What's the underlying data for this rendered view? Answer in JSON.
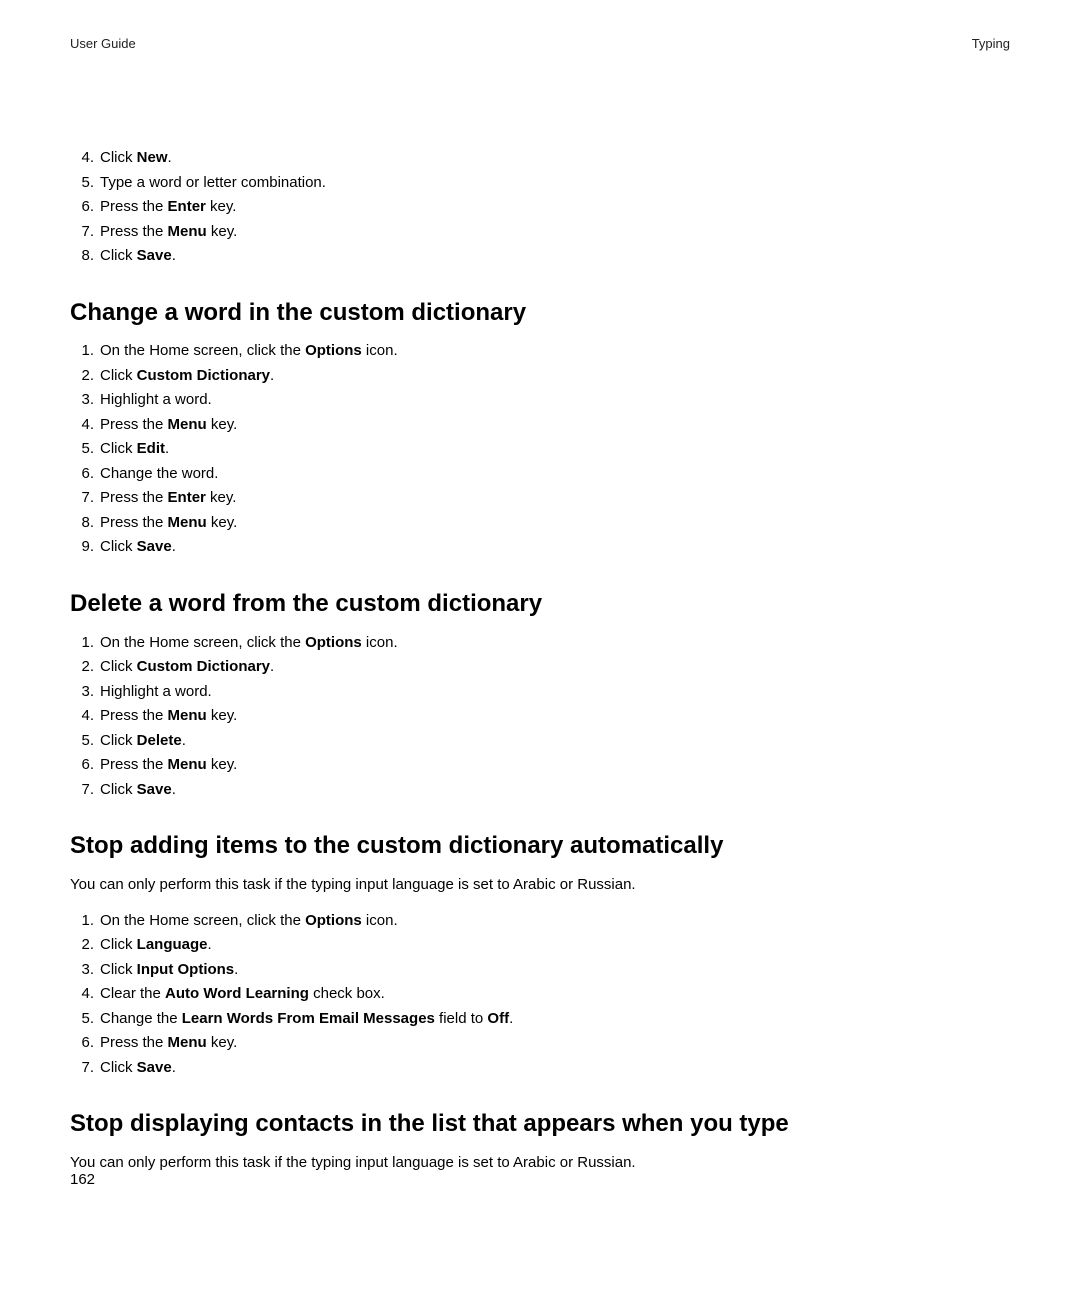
{
  "header": {
    "left": "User Guide",
    "right": "Typing"
  },
  "page_number": "162",
  "intro_steps": {
    "s4_pre": "Click ",
    "s4_b": "New",
    "s4_post": ".",
    "s5": "Type a word or letter combination.",
    "s6_pre": "Press the ",
    "s6_b": "Enter",
    "s6_post": " key.",
    "s7_pre": "Press the ",
    "s7_b": "Menu",
    "s7_post": " key.",
    "s8_pre": "Click ",
    "s8_b": "Save",
    "s8_post": "."
  },
  "section_change": {
    "heading": "Change a word in the custom dictionary",
    "s1_pre": "On the Home screen, click the ",
    "s1_b": "Options",
    "s1_post": " icon.",
    "s2_pre": "Click ",
    "s2_b": "Custom Dictionary",
    "s2_post": ".",
    "s3": "Highlight a word.",
    "s4_pre": "Press the ",
    "s4_b": "Menu",
    "s4_post": " key.",
    "s5_pre": "Click ",
    "s5_b": "Edit",
    "s5_post": ".",
    "s6": "Change the word.",
    "s7_pre": "Press the ",
    "s7_b": "Enter",
    "s7_post": " key.",
    "s8_pre": "Press the ",
    "s8_b": "Menu",
    "s8_post": " key.",
    "s9_pre": "Click ",
    "s9_b": "Save",
    "s9_post": "."
  },
  "section_delete": {
    "heading": "Delete a word from the custom dictionary",
    "s1_pre": "On the Home screen, click the ",
    "s1_b": "Options",
    "s1_post": " icon.",
    "s2_pre": "Click ",
    "s2_b": "Custom Dictionary",
    "s2_post": ".",
    "s3": "Highlight a word.",
    "s4_pre": "Press the ",
    "s4_b": "Menu",
    "s4_post": " key.",
    "s5_pre": "Click ",
    "s5_b": "Delete",
    "s5_post": ".",
    "s6_pre": "Press the ",
    "s6_b": "Menu",
    "s6_post": " key.",
    "s7_pre": "Click ",
    "s7_b": "Save",
    "s7_post": "."
  },
  "section_stop_add": {
    "heading": "Stop adding items to the custom dictionary automatically",
    "note": "You can only perform this task if the typing input language is set to Arabic or Russian.",
    "s1_pre": "On the Home screen, click the ",
    "s1_b": "Options",
    "s1_post": " icon.",
    "s2_pre": "Click ",
    "s2_b": "Language",
    "s2_post": ".",
    "s3_pre": "Click ",
    "s3_b": "Input Options",
    "s3_post": ".",
    "s4_pre": "Clear the ",
    "s4_b": "Auto Word Learning",
    "s4_post": " check box.",
    "s5_pre": "Change the ",
    "s5_b": "Learn Words From Email Messages",
    "s5_mid": " field to ",
    "s5_b2": "Off",
    "s5_post": ".",
    "s6_pre": "Press the ",
    "s6_b": "Menu",
    "s6_post": " key.",
    "s7_pre": "Click ",
    "s7_b": "Save",
    "s7_post": "."
  },
  "section_stop_contacts": {
    "heading": "Stop displaying contacts in the list that appears when you type",
    "note": "You can only perform this task if the typing input language is set to Arabic or Russian."
  }
}
